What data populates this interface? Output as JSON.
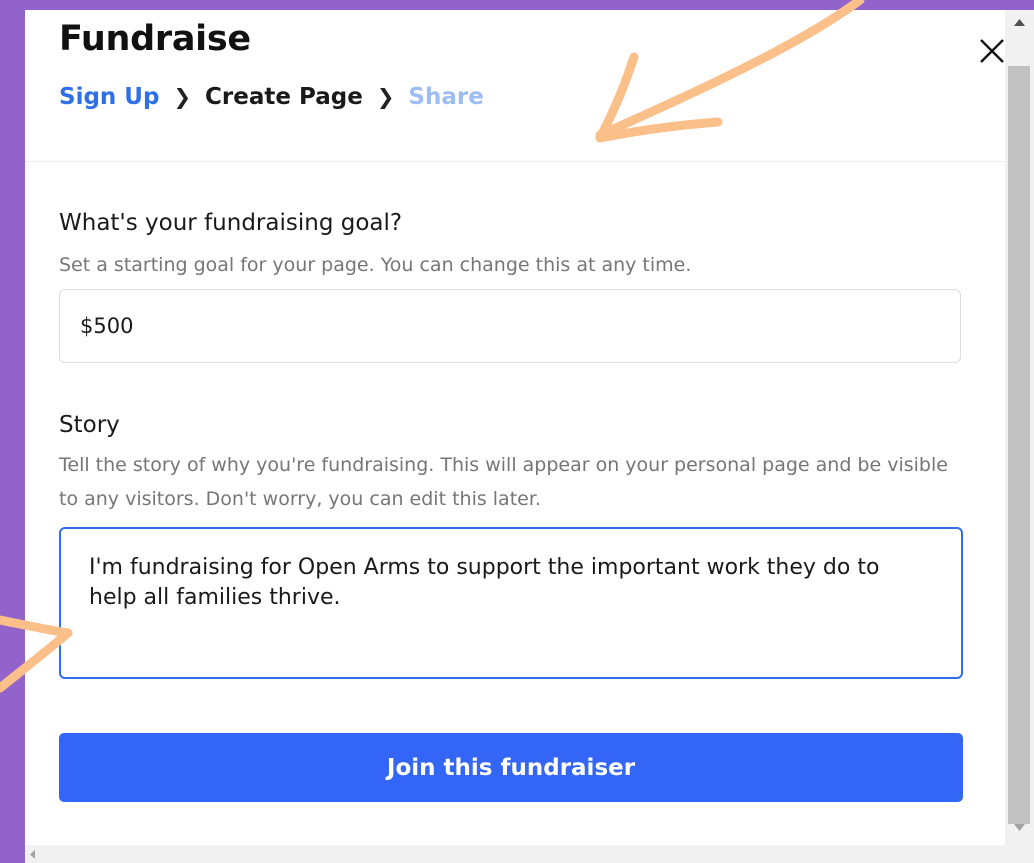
{
  "modal": {
    "title": "Fundraise",
    "breadcrumb": {
      "steps": [
        "Sign Up",
        "Create Page",
        "Share"
      ],
      "current": "Create Page"
    }
  },
  "goal": {
    "label": "What's your fundraising goal?",
    "help": "Set a starting goal for your page. You can change this at any time.",
    "value": "$500"
  },
  "story": {
    "label": "Story",
    "help": "Tell the story of why you're fundraising. This will appear on your personal page and be visible to any visitors. Don't worry, you can edit this later.",
    "value": "I'm fundraising for Open Arms to support the important work they do to help all families thrive."
  },
  "actions": {
    "join_label": "Join this fundraiser"
  },
  "colors": {
    "background": "#9163cb",
    "accent": "#3366f6",
    "annotation": "#fbbf8a"
  },
  "icons": {
    "close": "close-icon",
    "separator": "chevron-right-icon"
  }
}
